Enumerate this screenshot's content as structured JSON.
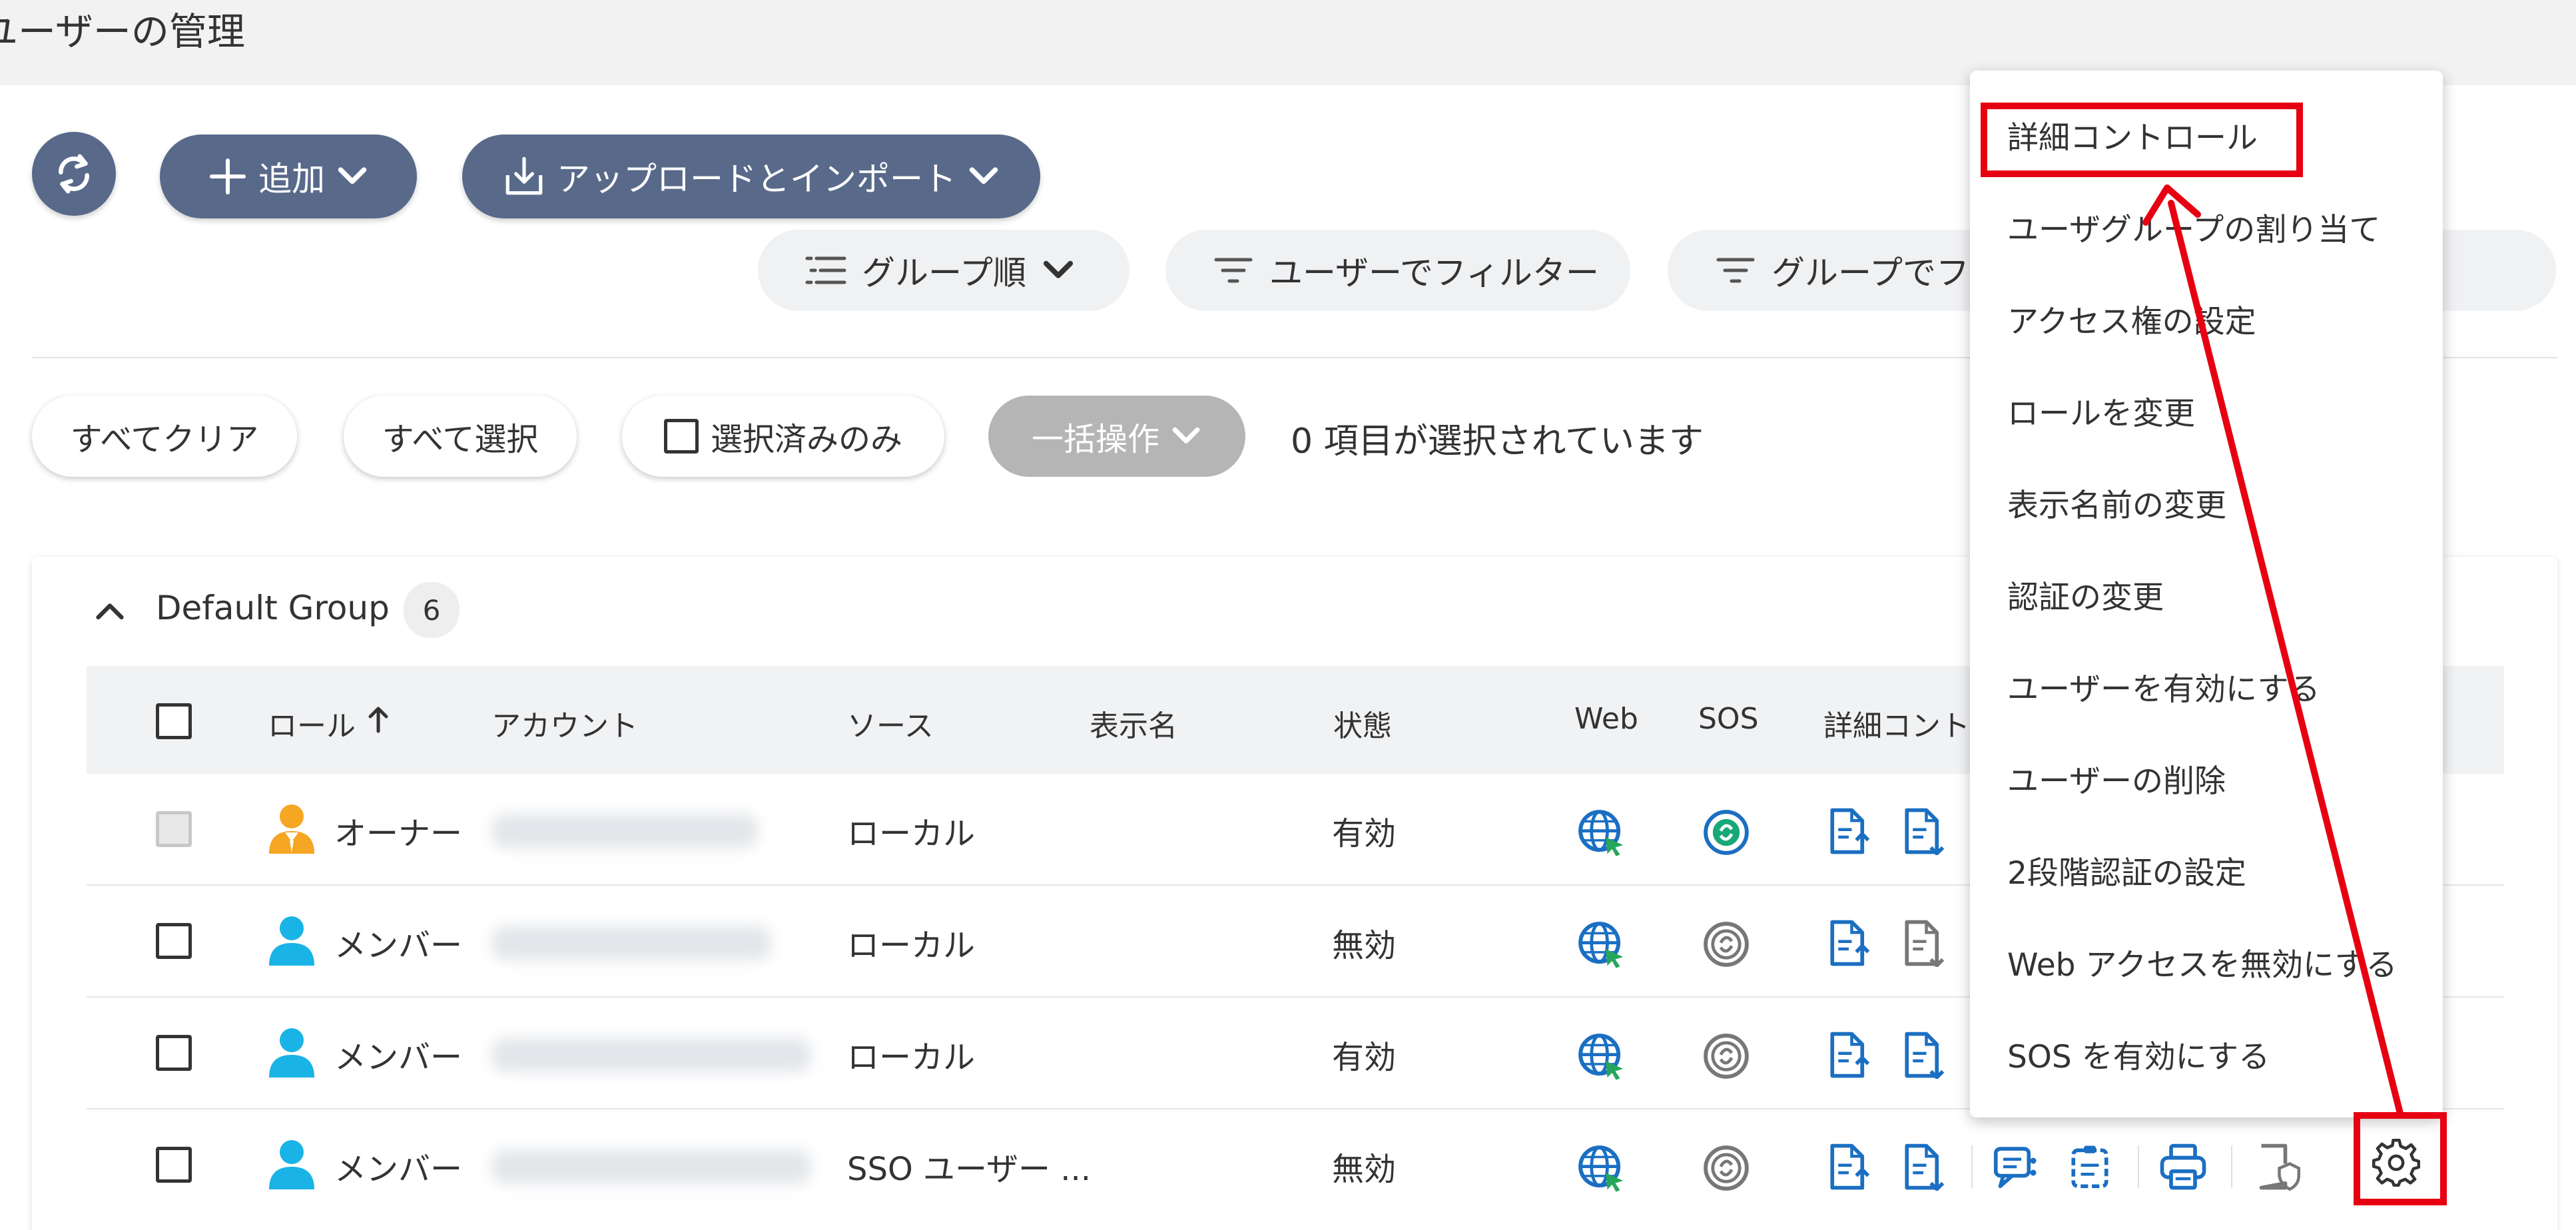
{
  "page": {
    "title": "ユーザーの管理"
  },
  "toolbar": {
    "add_label": "追加",
    "upload_label": "アップロードとインポート"
  },
  "filters": {
    "group_order": "グループ順",
    "filter_by_user": "ユーザーでフィルター",
    "filter_by_group": "グループでフィルター"
  },
  "selection": {
    "clear_all": "すべてクリア",
    "select_all": "すべて選択",
    "selected_only": "選択済みのみ",
    "bulk_action": "一括操作",
    "selected_count_text": "0 項目が選択されています"
  },
  "group": {
    "name": "Default Group",
    "count": "6"
  },
  "table": {
    "headers": {
      "role": "ロール",
      "account": "アカウント",
      "source": "ソース",
      "display_name": "表示名",
      "status": "状態",
      "web": "Web",
      "sos": "SOS",
      "detail": "詳細コントロール"
    },
    "rows": [
      {
        "role": "オーナー",
        "source": "ローカル",
        "status": "有効",
        "role_color": "#f5a623",
        "sos_enabled": true
      },
      {
        "role": "メンバー",
        "source": "ローカル",
        "status": "無効",
        "role_color": "#1ab3e6",
        "sos_enabled": false
      },
      {
        "role": "メンバー",
        "source": "ローカル",
        "status": "有効",
        "role_color": "#1ab3e6",
        "sos_enabled": false
      },
      {
        "role": "メンバー",
        "source": "SSO ユーザー ...",
        "status": "無効",
        "role_color": "#1ab3e6",
        "sos_enabled": false
      }
    ]
  },
  "context_menu": {
    "items": [
      "詳細コントロール",
      "ユーザグループの割り当て",
      "アクセス権の設定",
      "ロールを変更",
      "表示名前の変更",
      "認証の変更",
      "ユーザーを有効にする",
      "ユーザーの削除",
      "2段階認証の設定",
      "Web アクセスを無効にする",
      "SOS を有効にする"
    ]
  },
  "colors": {
    "primary": "#58698a",
    "icon_blue": "#1b6fc2",
    "sos_green": "#18a878",
    "annotation_red": "#e60012"
  }
}
